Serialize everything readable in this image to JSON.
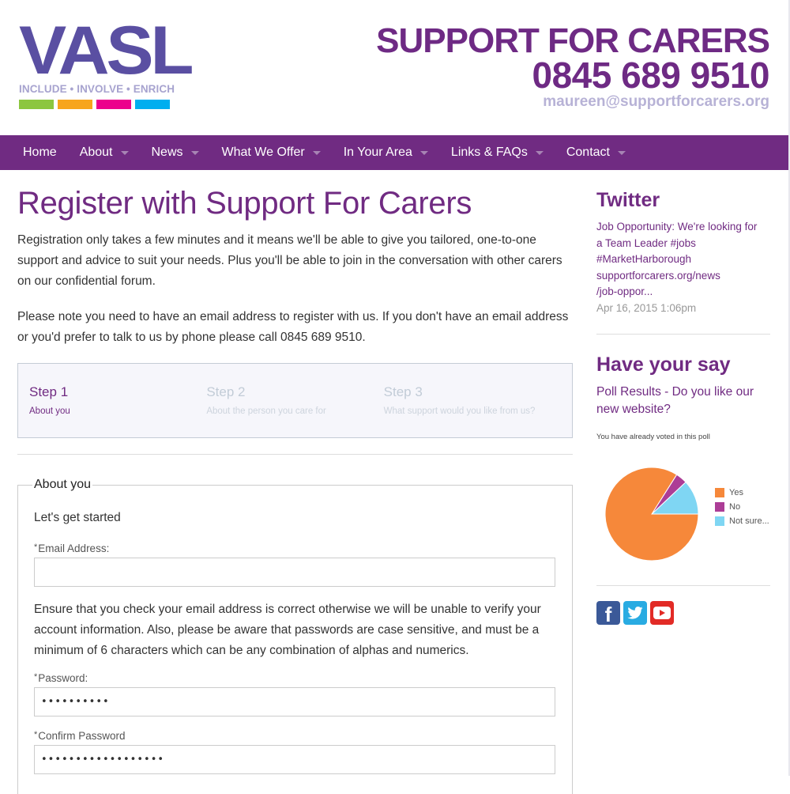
{
  "header": {
    "logo": {
      "word": "VASL",
      "tagline": "INCLUDE • INVOLVE • ENRICH",
      "bar_colors": [
        "#8cc63f",
        "#f7a51c",
        "#ec008c",
        "#00aeef"
      ]
    },
    "contact": {
      "tagline": "SUPPORT FOR CARERS",
      "phone": "0845 689 9510",
      "email": "maureen@supportforcarers.org"
    }
  },
  "nav": {
    "items": [
      {
        "label": "Home",
        "dropdown": false
      },
      {
        "label": "About",
        "dropdown": true
      },
      {
        "label": "News",
        "dropdown": true
      },
      {
        "label": "What We Offer",
        "dropdown": true
      },
      {
        "label": "In Your Area",
        "dropdown": true
      },
      {
        "label": "Links & FAQs",
        "dropdown": true
      },
      {
        "label": "Contact",
        "dropdown": true
      }
    ]
  },
  "main": {
    "title": "Register with Support For Carers",
    "intro": [
      "Registration only takes a few minutes and it means we'll be able to give you tailored, one-to-one support and advice to suit your needs. Plus you'll be able to join in the conversation with other carers on our confidential forum.",
      "Please note you need to have an email address to register with us. If you don't have an email address or you'd prefer to talk to us by phone please call 0845 689 9510."
    ],
    "steps": [
      {
        "title": "Step 1",
        "subtitle": "About you",
        "active": true
      },
      {
        "title": "Step 2",
        "subtitle": "About the person you care for",
        "active": false
      },
      {
        "title": "Step 3",
        "subtitle": "What support would you like from us?",
        "active": false
      }
    ],
    "form": {
      "legend": "About you",
      "intro": "Let's get started",
      "email": {
        "required_mark": "*",
        "label": "Email Address:",
        "value": ""
      },
      "note": "Ensure that you check your email address is correct otherwise we will be unable to verify your account information. Also, please be aware that passwords are case sensitive, and must be a minimum of 6 characters which can be any combination of alphas and numerics.",
      "password": {
        "required_mark": "*",
        "label": "Password:",
        "masked_value": "••••••••••"
      },
      "confirm_password": {
        "required_mark": "*",
        "label": "Confirm Password",
        "masked_value": "••••••••••••••••••"
      }
    }
  },
  "sidebar": {
    "twitter": {
      "heading": "Twitter",
      "tweet_lines": [
        "Job Opportunity: We're looking for",
        "a Team Leader #jobs",
        "#MarketHarborough",
        "supportforcarers.org/news",
        "/job-oppor..."
      ],
      "date": "Apr 16, 2015 1:06pm"
    },
    "poll": {
      "heading": "Have your say",
      "title": "Poll Results - Do you like our new website?",
      "voted_note": "You have already voted in this poll"
    },
    "social": [
      {
        "name": "facebook",
        "glyph": "f",
        "color": "#3b5998"
      },
      {
        "name": "twitter",
        "glyph": "🐦",
        "color": "#29abe2"
      },
      {
        "name": "youtube",
        "glyph": "▶",
        "color": "#e22b26"
      }
    ]
  },
  "chart_data": {
    "type": "pie",
    "title": "Poll Results - Do you like our new website?",
    "categories": [
      "Yes",
      "No",
      "Not sure..."
    ],
    "values": [
      84,
      4,
      12
    ],
    "unit": "percent (estimated)",
    "colors": [
      "#f6883a",
      "#ac3d96",
      "#7fd6f3"
    ],
    "start_angle": "clockwise from 12 o'clock",
    "legend": "right"
  }
}
